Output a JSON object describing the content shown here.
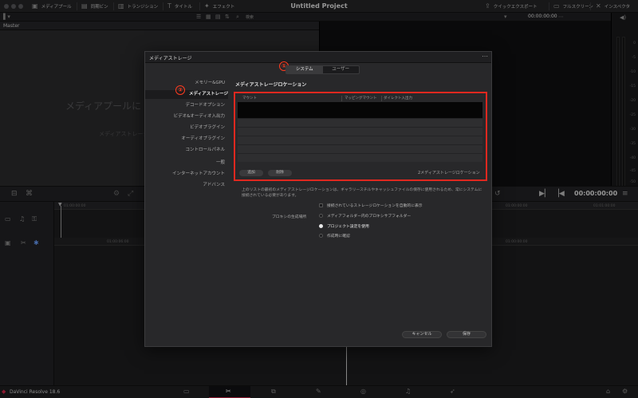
{
  "topbar": {
    "media_pool": "メディアプール",
    "sync_bin": "同期ビン",
    "transitions": "トランジション",
    "titles": "タイトル",
    "effects": "エフェクト",
    "project_title": "Untitled Project",
    "quick_export": "クイックエクスポート",
    "full_screen": "フルスクリーン",
    "inspector": "インスペクタ"
  },
  "toolbar2": {
    "search_label": "検索",
    "timecode": "00:00:00:00"
  },
  "master_label": "Master",
  "pool_empty_big": "メディアプールに",
  "pool_empty_small": "メディアストレージ",
  "meter_ticks": [
    "0",
    "-5",
    "-10",
    "-15",
    "-20",
    "-25",
    "-30",
    "-35",
    "-40",
    "-45",
    "-50"
  ],
  "timeline": {
    "timecode": "00:00:00:00",
    "ruler_left": "01:00:00:00",
    "ruler_mid": "01:00:00:00",
    "ruler_r1": "01:00:06:00",
    "ruler_r2": "01:01:00:00"
  },
  "dialog": {
    "title": "メディアストレージ",
    "tabs": [
      "システム",
      "ユーザー"
    ],
    "annotations": [
      "①",
      "②"
    ],
    "nav": [
      "メモリー&GPU",
      "メディアストレージ",
      "デコードオプション",
      "ビデオ&オーディオ入出力",
      "ビデオプラグイン",
      "オーディオプラグイン",
      "コントロールパネル",
      "一般",
      "インターネットアカウント",
      "アドバンス"
    ],
    "section_title": "メディアストレージロケーション",
    "columns": [
      "マウント",
      "マッピングマウント",
      "ダイレクト入出力"
    ],
    "add_button": "追加",
    "remove_button": "削除",
    "location_count": "2メディアストレージロケーション",
    "note": "上のリストの最初のメディアストレージロケーションは、ギャラリースチルやキャッシュファイルの保存に使用されるため、常にシステムに接続されている必要があります。",
    "auto_display": "接続されているストレージロケーションを自動的に表示",
    "proxy_label": "プロキシの生成場所",
    "proxy_options": [
      "メディアフォルダー内のプロキシサブフォルダー",
      "プロジェクト設定を使用",
      "作成時に確認"
    ],
    "cancel": "キャンセル",
    "save": "保存"
  },
  "bottombar": {
    "brand": "DaVinci Resolve 18.6"
  },
  "colors": {
    "accent_red": "#e0281f",
    "active_page": "#d7284b"
  }
}
